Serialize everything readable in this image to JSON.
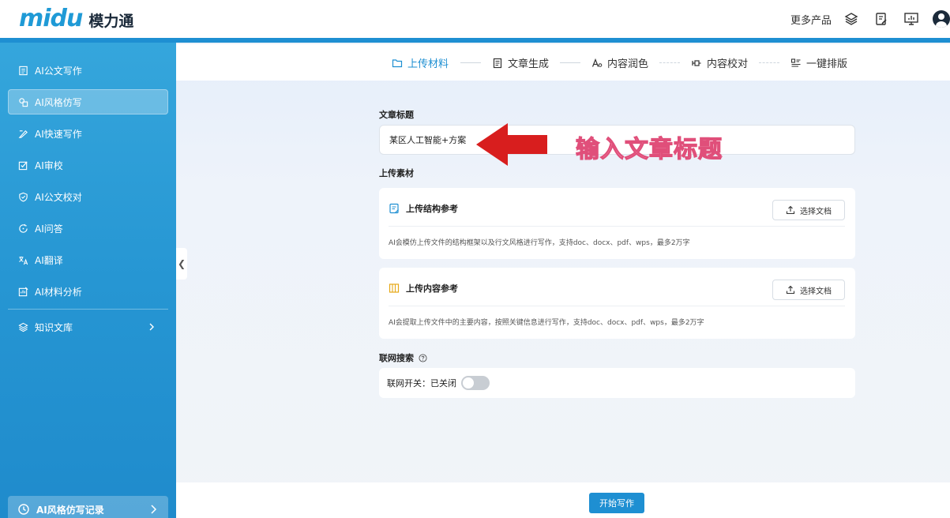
{
  "header": {
    "logo_mark": "midu",
    "brand_name": "模力通",
    "more_products": "更多产品",
    "icons": [
      "layers-icon",
      "edit-note-icon",
      "presentation-icon",
      "user-avatar-icon"
    ]
  },
  "sidebar": {
    "items": [
      {
        "label": "AI公文写作",
        "icon": "document-icon"
      },
      {
        "label": "AI风格仿写",
        "icon": "style-icon",
        "active": true
      },
      {
        "label": "AI快速写作",
        "icon": "quick-write-icon"
      },
      {
        "label": "AI审校",
        "icon": "review-icon"
      },
      {
        "label": "AI公文校对",
        "icon": "shield-check-icon"
      },
      {
        "label": "AI问答",
        "icon": "qa-icon"
      },
      {
        "label": "AI翻译",
        "icon": "translate-icon"
      },
      {
        "label": "AI材料分析",
        "icon": "analysis-icon"
      }
    ],
    "knowledge": {
      "label": "知识文库",
      "icon": "layers-icon"
    },
    "history": {
      "label": "AI风格仿写记录",
      "icon": "clock-icon"
    }
  },
  "steps": [
    {
      "label": "上传材料",
      "icon": "folder-icon",
      "current": true
    },
    {
      "label": "文章生成",
      "icon": "doc-icon"
    },
    {
      "label": "内容润色",
      "icon": "text-style-icon"
    },
    {
      "label": "内容校对",
      "icon": "proofread-icon"
    },
    {
      "label": "一键排版",
      "icon": "layout-icon"
    }
  ],
  "form": {
    "title_label": "文章标题",
    "title_value": "某区人工智能+方案",
    "materials_label": "上传素材",
    "structure": {
      "title": "上传结构参考",
      "button": "选择文档",
      "desc": "AI会模仿上传文件的结构框架以及行文风格进行写作，支持doc、docx、pdf、wps，最多2万字"
    },
    "content": {
      "title": "上传内容参考",
      "button": "选择文档",
      "desc": "AI会提取上传文件中的主要内容，按照关键信息进行写作，支持doc、docx、pdf、wps，最多2万字"
    },
    "network_label": "联网搜索",
    "network_switch_label": "联网开关：",
    "network_state": "已关闭",
    "network_on": false
  },
  "annotation": {
    "text": "输入文章标题",
    "colors": {
      "fill": "#f9a8c4",
      "stroke": "#e04f7a",
      "arrow": "#d81e1e"
    }
  },
  "actions": {
    "start": "开始写作"
  },
  "colors": {
    "accent": "#1e8fd2",
    "sidebar_top": "#35a6dc",
    "sidebar_bottom": "#1f8bcc"
  }
}
